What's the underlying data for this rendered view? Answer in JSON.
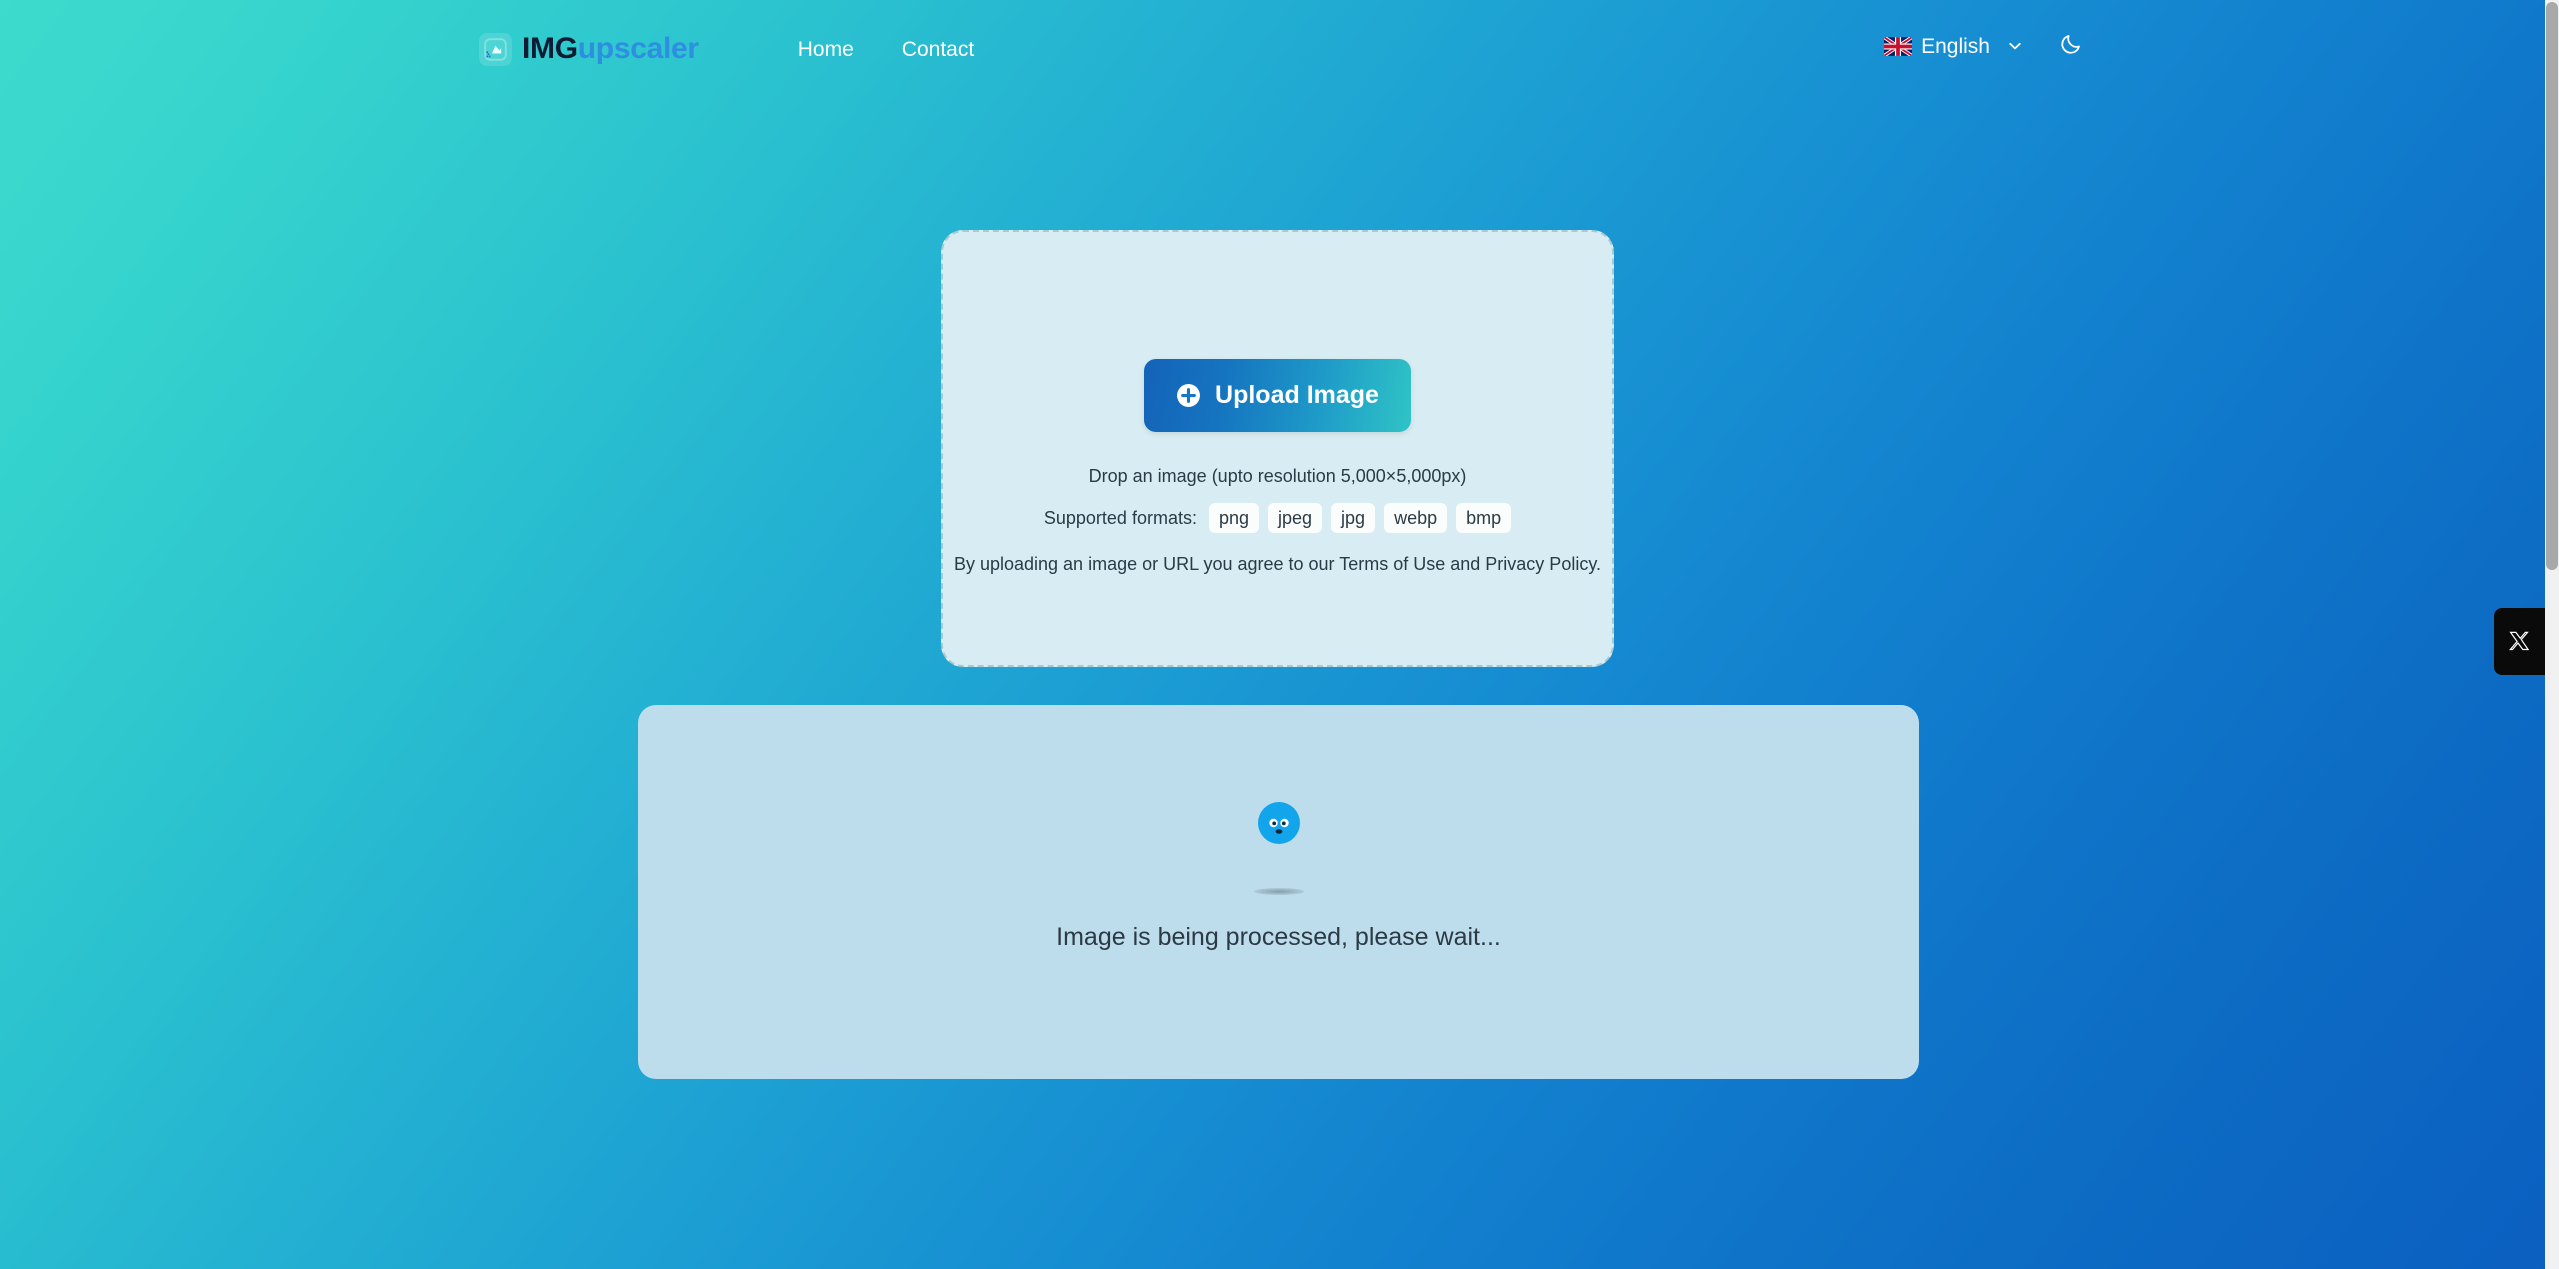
{
  "header": {
    "logo": {
      "icon": "image-upscale-logo-icon",
      "text_primary": "IMG",
      "text_secondary": "upscaler"
    },
    "nav": [
      {
        "label": "Home",
        "name": "nav-link-home"
      },
      {
        "label": "Contact",
        "name": "nav-link-contact"
      }
    ],
    "language": {
      "icon": "uk-flag-icon",
      "label": "English",
      "chevron": "chevron-down-icon"
    },
    "theme_toggle": {
      "icon": "moon-icon",
      "label": "Dark mode"
    }
  },
  "upload": {
    "button_label": "Upload Image",
    "button_icon": "plus-circle-icon",
    "drop_hint": "Drop an image (upto resolution 5,000×5,000px)",
    "formats_label": "Supported formats:",
    "formats": [
      "png",
      "jpeg",
      "jpg",
      "webp",
      "bmp"
    ],
    "terms": {
      "prefix": "By uploading an image or URL you agree to our ",
      "terms_link": "Terms of Use",
      "middle": " and ",
      "privacy_link": "Privacy Policy",
      "suffix": "."
    }
  },
  "result": {
    "loader_icon": "bouncing-ball-loader-icon",
    "status_text": "Image is being processed, please wait..."
  },
  "social": {
    "x_tab_icon": "x-twitter-icon",
    "x_tab_label": "X"
  },
  "colors": {
    "bg_gradient_start": "#3ddbcd",
    "bg_gradient_end": "#0b5fc0",
    "upload_card_bg": "#d8edf3",
    "upload_card_border": "#a9c9d3",
    "result_card_bg": "#bddcec",
    "button_gradient_start": "#1463b8",
    "button_gradient_end": "#2fc4c6",
    "brand_primary": "#0d1b33",
    "brand_secondary": "#2e8fe0",
    "loader_ball": "#12a5ec",
    "text_dark": "#2a3b45",
    "nav_text": "#ffffff",
    "x_tab_bg": "#0a0a0a",
    "scrollbar_thumb": "#a8a8a8"
  }
}
